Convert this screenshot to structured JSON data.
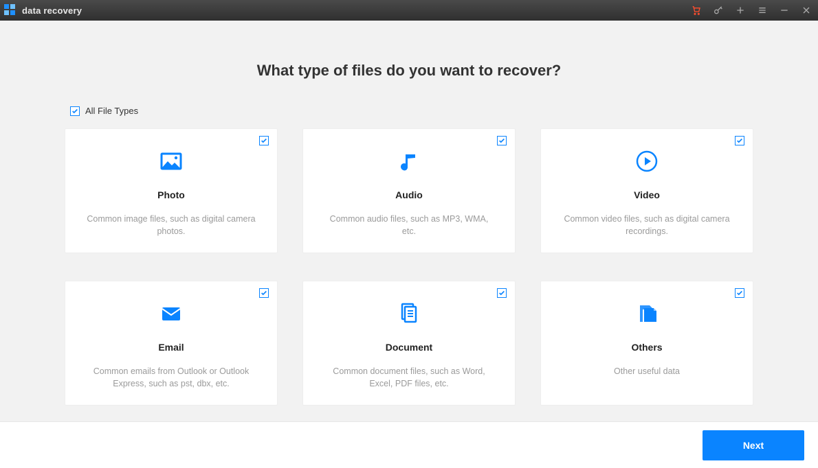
{
  "titlebar": {
    "app_name": "data recovery"
  },
  "main": {
    "heading": "What type of files do you want to recover?",
    "all_label": "All File Types",
    "all_checked": true
  },
  "cards": [
    {
      "id": "photo",
      "title": "Photo",
      "desc": "Common image files, such as digital camera photos.",
      "checked": true
    },
    {
      "id": "audio",
      "title": "Audio",
      "desc": "Common audio files, such as MP3, WMA, etc.",
      "checked": true
    },
    {
      "id": "video",
      "title": "Video",
      "desc": "Common video files, such as digital camera recordings.",
      "checked": true
    },
    {
      "id": "email",
      "title": "Email",
      "desc": "Common emails from Outlook or Outlook Express, such as pst, dbx, etc.",
      "checked": true
    },
    {
      "id": "document",
      "title": "Document",
      "desc": "Common document files, such as Word, Excel, PDF files, etc.",
      "checked": true
    },
    {
      "id": "others",
      "title": "Others",
      "desc": "Other useful data",
      "checked": true
    }
  ],
  "footer": {
    "next_label": "Next"
  },
  "colors": {
    "accent": "#0a84ff",
    "cart": "#ff4d2e"
  }
}
